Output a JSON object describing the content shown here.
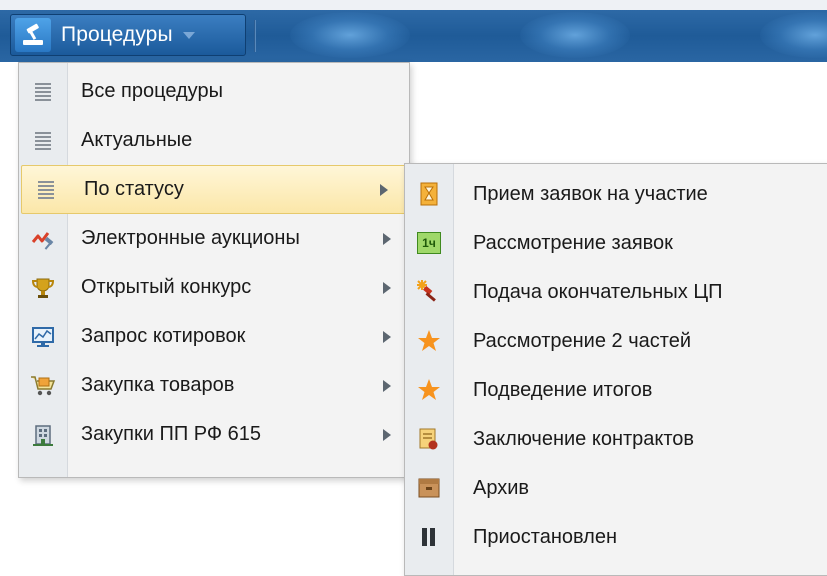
{
  "toolbar": {
    "menu_title": "Процедуры"
  },
  "main_menu": {
    "items": [
      {
        "label": "Все процедуры",
        "icon": "list-icon",
        "has_submenu": false
      },
      {
        "label": "Актуальные",
        "icon": "list-icon",
        "has_submenu": false
      },
      {
        "label": "По статусу",
        "icon": "list-icon",
        "has_submenu": true,
        "active": true
      },
      {
        "label": "Электронные аукционы",
        "icon": "auction-hammer-icon",
        "has_submenu": true
      },
      {
        "label": "Открытый конкурс",
        "icon": "trophy-icon",
        "has_submenu": true
      },
      {
        "label": "Запрос котировок",
        "icon": "monitor-chart-icon",
        "has_submenu": true
      },
      {
        "label": "Закупка товаров",
        "icon": "shopping-cart-icon",
        "has_submenu": true
      },
      {
        "label": "Закупки ПП РФ 615",
        "icon": "building-icon",
        "has_submenu": true
      }
    ]
  },
  "status_submenu": {
    "items": [
      {
        "label": "Прием заявок на участие",
        "icon": "hourglass-icon"
      },
      {
        "label": "Рассмотрение заявок",
        "icon": "one-hour-icon",
        "icon_text": "1ч"
      },
      {
        "label": "Подача окончательных ЦП",
        "icon": "hammer-spark-icon"
      },
      {
        "label": "Рассмотрение 2 частей",
        "icon": "star-icon"
      },
      {
        "label": "Подведение итогов",
        "icon": "star-icon"
      },
      {
        "label": "Заключение контрактов",
        "icon": "contract-seal-icon"
      },
      {
        "label": "Архив",
        "icon": "archive-box-icon"
      },
      {
        "label": "Приостановлен",
        "icon": "pause-icon"
      }
    ]
  },
  "colors": {
    "toolbar": "#1f5b98",
    "highlight": "#fbe7a9",
    "menu_bg": "#f3f3f3",
    "star": "#f7931e"
  }
}
